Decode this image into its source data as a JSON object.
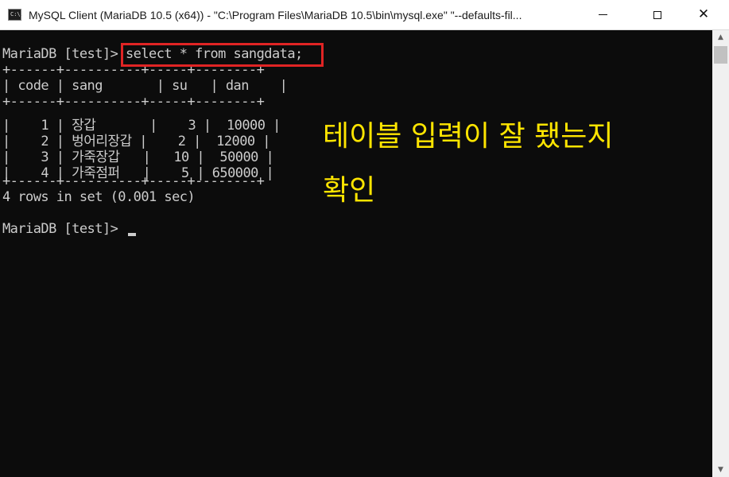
{
  "window": {
    "icon_text": "C:\\.",
    "title": "MySQL Client (MariaDB 10.5 (x64)) - \"C:\\Program Files\\MariaDB 10.5\\bin\\mysql.exe\"  \"--defaults-fil...",
    "controls": {
      "minimize_icon": "minimize-icon",
      "maximize_icon": "maximize-icon",
      "close_icon": "close-icon",
      "close_glyph": "✕"
    }
  },
  "console": {
    "prompt_command": "MariaDB [test]> select * from sangdata;",
    "separator": "+------+----------+-----+--------+",
    "header_row": "| code | sang       | su   | dan    |",
    "rows": [
      "|    1 | 장갑       |    3 |  10000 |",
      "|    2 | 벙어리장갑 |    2 |  12000 |",
      "|    3 | 가죽장갑   |   10 |  50000 |",
      "|    4 | 가죽점퍼   |    5 | 650000 |"
    ],
    "result_summary": "4 rows in set (0.001 sec)",
    "prompt_idle": "MariaDB [test]> "
  },
  "annotation": {
    "line1": "테이블 입력이 잘 됐는지",
    "line2": "확인",
    "color": "#ffe500",
    "highlight_color": "#e02424"
  },
  "scrollbar": {
    "up_glyph": "▲",
    "down_glyph": "▼"
  }
}
